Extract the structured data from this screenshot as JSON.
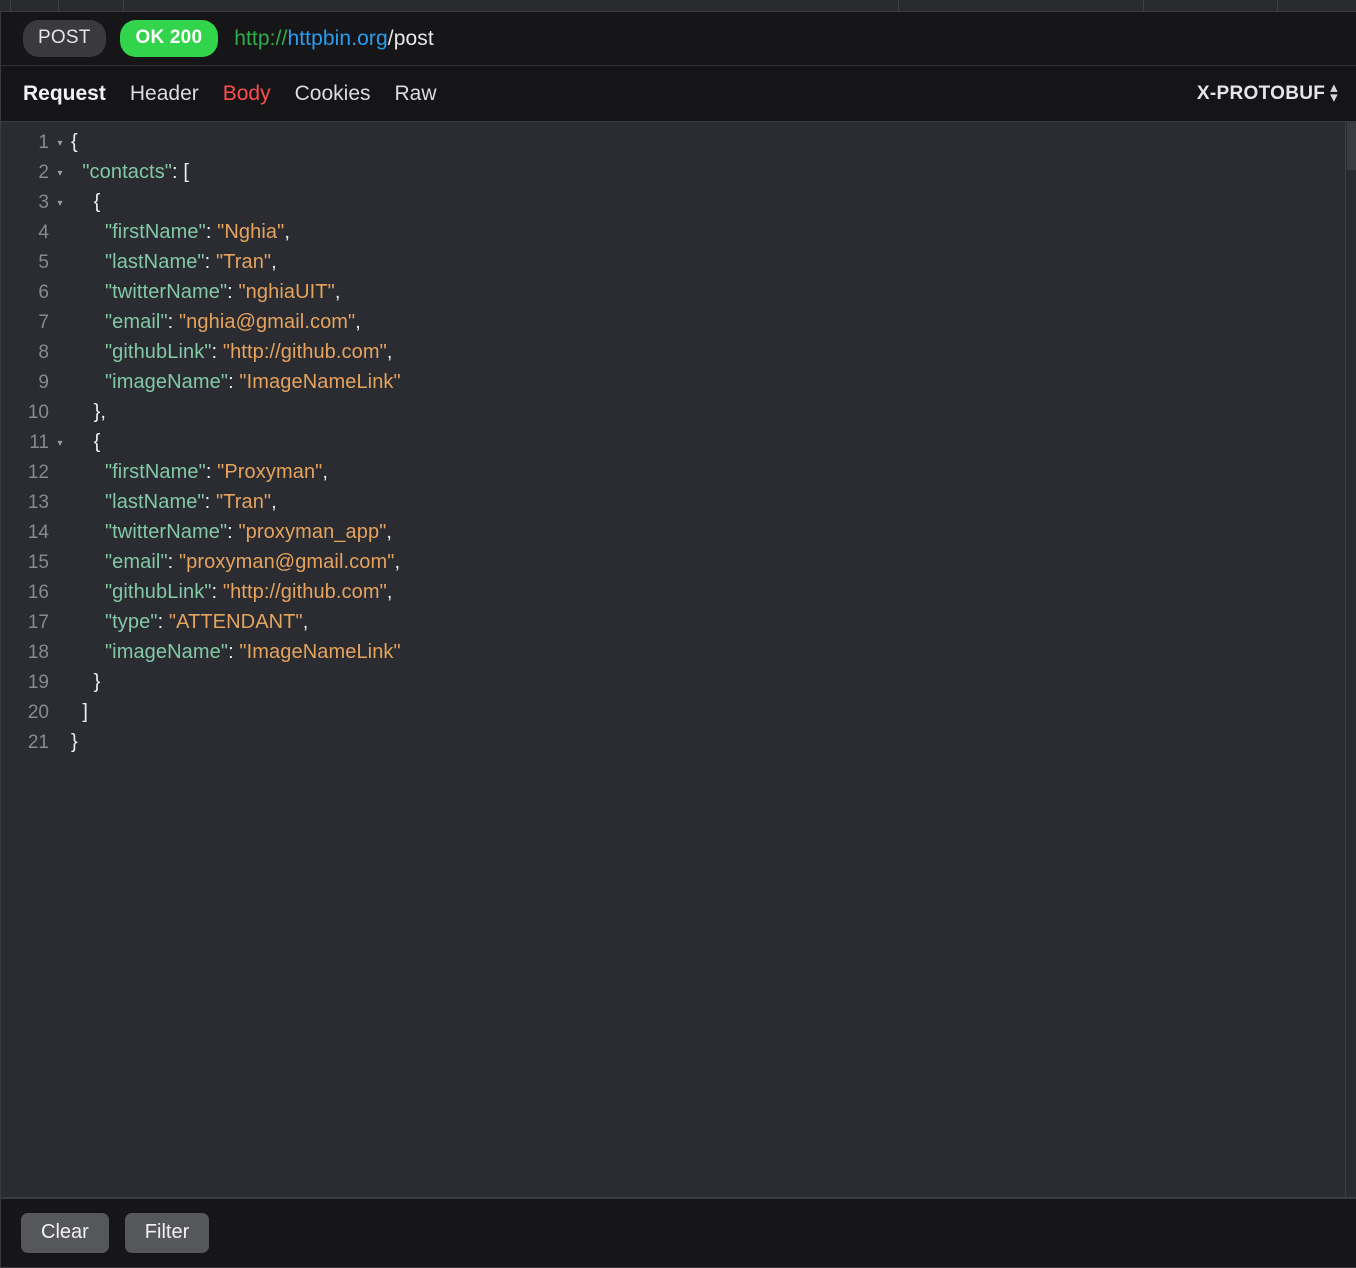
{
  "table_header": {
    "divider_positions": [
      10,
      58,
      123,
      898,
      1143,
      1277
    ]
  },
  "url_bar": {
    "method": "POST",
    "status": "OK 200",
    "url_scheme": "http://",
    "url_host": "httpbin.org",
    "url_path": "/post"
  },
  "tabs": {
    "items": [
      {
        "label": "Request",
        "style": "primary"
      },
      {
        "label": "Header",
        "style": "normal"
      },
      {
        "label": "Body",
        "style": "active-red"
      },
      {
        "label": "Cookies",
        "style": "normal"
      },
      {
        "label": "Raw",
        "style": "normal"
      }
    ],
    "encoding_label": "X-PROTOBUF",
    "stepper_up": "▴",
    "stepper_down": "▾"
  },
  "editor": {
    "fold_glyph": "▾",
    "lines": [
      {
        "n": "1",
        "fold": true,
        "indent": 0,
        "tokens": [
          {
            "t": "punct",
            "v": "{"
          }
        ]
      },
      {
        "n": "2",
        "fold": true,
        "indent": 1,
        "tokens": [
          {
            "t": "key",
            "v": "\"contacts\""
          },
          {
            "t": "punct",
            "v": ": ["
          }
        ]
      },
      {
        "n": "3",
        "fold": true,
        "indent": 2,
        "tokens": [
          {
            "t": "punct",
            "v": "{"
          }
        ]
      },
      {
        "n": "4",
        "fold": false,
        "indent": 3,
        "tokens": [
          {
            "t": "key",
            "v": "\"firstName\""
          },
          {
            "t": "punct",
            "v": ": "
          },
          {
            "t": "str",
            "v": "\"Nghia\""
          },
          {
            "t": "punct",
            "v": ","
          }
        ]
      },
      {
        "n": "5",
        "fold": false,
        "indent": 3,
        "tokens": [
          {
            "t": "key",
            "v": "\"lastName\""
          },
          {
            "t": "punct",
            "v": ": "
          },
          {
            "t": "str",
            "v": "\"Tran\""
          },
          {
            "t": "punct",
            "v": ","
          }
        ]
      },
      {
        "n": "6",
        "fold": false,
        "indent": 3,
        "tokens": [
          {
            "t": "key",
            "v": "\"twitterName\""
          },
          {
            "t": "punct",
            "v": ": "
          },
          {
            "t": "str",
            "v": "\"nghiaUIT\""
          },
          {
            "t": "punct",
            "v": ","
          }
        ]
      },
      {
        "n": "7",
        "fold": false,
        "indent": 3,
        "tokens": [
          {
            "t": "key",
            "v": "\"email\""
          },
          {
            "t": "punct",
            "v": ": "
          },
          {
            "t": "str",
            "v": "\"nghia@gmail.com\""
          },
          {
            "t": "punct",
            "v": ","
          }
        ]
      },
      {
        "n": "8",
        "fold": false,
        "indent": 3,
        "tokens": [
          {
            "t": "key",
            "v": "\"githubLink\""
          },
          {
            "t": "punct",
            "v": ": "
          },
          {
            "t": "str",
            "v": "\"http://github.com\""
          },
          {
            "t": "punct",
            "v": ","
          }
        ]
      },
      {
        "n": "9",
        "fold": false,
        "indent": 3,
        "tokens": [
          {
            "t": "key",
            "v": "\"imageName\""
          },
          {
            "t": "punct",
            "v": ": "
          },
          {
            "t": "str",
            "v": "\"ImageNameLink\""
          }
        ]
      },
      {
        "n": "10",
        "fold": false,
        "indent": 2,
        "tokens": [
          {
            "t": "punct",
            "v": "},"
          }
        ]
      },
      {
        "n": "11",
        "fold": true,
        "indent": 2,
        "tokens": [
          {
            "t": "punct",
            "v": "{"
          }
        ]
      },
      {
        "n": "12",
        "fold": false,
        "indent": 3,
        "tokens": [
          {
            "t": "key",
            "v": "\"firstName\""
          },
          {
            "t": "punct",
            "v": ": "
          },
          {
            "t": "str",
            "v": "\"Proxyman\""
          },
          {
            "t": "punct",
            "v": ","
          }
        ]
      },
      {
        "n": "13",
        "fold": false,
        "indent": 3,
        "tokens": [
          {
            "t": "key",
            "v": "\"lastName\""
          },
          {
            "t": "punct",
            "v": ": "
          },
          {
            "t": "str",
            "v": "\"Tran\""
          },
          {
            "t": "punct",
            "v": ","
          }
        ]
      },
      {
        "n": "14",
        "fold": false,
        "indent": 3,
        "tokens": [
          {
            "t": "key",
            "v": "\"twitterName\""
          },
          {
            "t": "punct",
            "v": ": "
          },
          {
            "t": "str",
            "v": "\"proxyman_app\""
          },
          {
            "t": "punct",
            "v": ","
          }
        ]
      },
      {
        "n": "15",
        "fold": false,
        "indent": 3,
        "tokens": [
          {
            "t": "key",
            "v": "\"email\""
          },
          {
            "t": "punct",
            "v": ": "
          },
          {
            "t": "str",
            "v": "\"proxyman@gmail.com\""
          },
          {
            "t": "punct",
            "v": ","
          }
        ]
      },
      {
        "n": "16",
        "fold": false,
        "indent": 3,
        "tokens": [
          {
            "t": "key",
            "v": "\"githubLink\""
          },
          {
            "t": "punct",
            "v": ": "
          },
          {
            "t": "str",
            "v": "\"http://github.com\""
          },
          {
            "t": "punct",
            "v": ","
          }
        ]
      },
      {
        "n": "17",
        "fold": false,
        "indent": 3,
        "tokens": [
          {
            "t": "key",
            "v": "\"type\""
          },
          {
            "t": "punct",
            "v": ": "
          },
          {
            "t": "str",
            "v": "\"ATTENDANT\""
          },
          {
            "t": "punct",
            "v": ","
          }
        ]
      },
      {
        "n": "18",
        "fold": false,
        "indent": 3,
        "tokens": [
          {
            "t": "key",
            "v": "\"imageName\""
          },
          {
            "t": "punct",
            "v": ": "
          },
          {
            "t": "str",
            "v": "\"ImageNameLink\""
          }
        ]
      },
      {
        "n": "19",
        "fold": false,
        "indent": 2,
        "tokens": [
          {
            "t": "punct",
            "v": "}"
          }
        ]
      },
      {
        "n": "20",
        "fold": false,
        "indent": 1,
        "tokens": [
          {
            "t": "punct",
            "v": "]"
          }
        ]
      },
      {
        "n": "21",
        "fold": false,
        "indent": 0,
        "tokens": [
          {
            "t": "punct",
            "v": "}"
          }
        ]
      }
    ]
  },
  "bottom_toolbar": {
    "clear_label": "Clear",
    "filter_label": "Filter"
  },
  "colors": {
    "status_green": "#31d44a",
    "tab_active_red": "#ff4d4f",
    "json_key": "#83c9a6",
    "json_string": "#e6a35c",
    "url_scheme_green": "#2faf4b",
    "url_host_blue": "#2b9cf0",
    "editor_bg": "#2a2c32"
  }
}
